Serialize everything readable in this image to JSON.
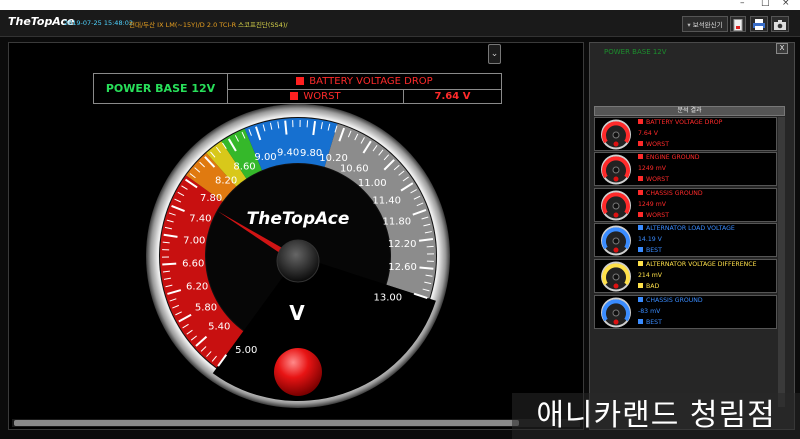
{
  "window": {
    "minimize": "–",
    "maximize": "□",
    "close": "×"
  },
  "header": {
    "logo": "TheTopAce",
    "datetime": "2019-07-25 15:48:02",
    "vehicle": "현대/두산 IX LM(~15Y)/D 2.0 TCI-R",
    "procedure": "스코프진단(SS4)/",
    "report_button": "보석완신기",
    "tool_icons": [
      "document-icon",
      "printer-icon",
      "camera-icon"
    ]
  },
  "main": {
    "dropdown_symbol": "⌄",
    "power_base": "POWER BASE 12V",
    "test_name": "BATTERY VOLTAGE DROP",
    "grade": "WORST",
    "measured_value": "7.64 V"
  },
  "gauge": {
    "brand": "TheTopAce",
    "unit": "V",
    "min": 5.0,
    "max": 13.0,
    "value": 7.64,
    "tick_labels": [
      "5.00",
      "5.40",
      "5.80",
      "6.20",
      "6.60",
      "7.00",
      "7.40",
      "7.80",
      "8.20",
      "8.60",
      "9.00",
      "9.40",
      "9.80",
      "10.20",
      "10.60",
      "11.00",
      "11.40",
      "11.80",
      "12.20",
      "12.60",
      "13.00"
    ],
    "colors": {
      "red": "#c81010",
      "orange": "#e07a10",
      "yellow": "#d8c81a",
      "green": "#35b82a",
      "blue": "#1670d0",
      "gray": "#8c8c8c",
      "needle": "#d01414"
    }
  },
  "analysis": {
    "panel_title": "POWER BASE 12V",
    "close_label": "X",
    "header": "분석 결과",
    "items": [
      {
        "name": "BATTERY VOLTAGE DROP",
        "value": "7.64 V",
        "grade": "WORST",
        "name_color": "#ff2a2a",
        "grade_color": "#ff2a2a",
        "square_color": "#ff2a2a"
      },
      {
        "name": "ENGINE GROUND",
        "value": "1249 mV",
        "grade": "WORST",
        "name_color": "#ff2a2a",
        "grade_color": "#ff2a2a",
        "square_color": "#ff2a2a"
      },
      {
        "name": "CHASSIS GROUND",
        "value": "1249 mV",
        "grade": "WORST",
        "name_color": "#ff2a2a",
        "grade_color": "#ff2a2a",
        "square_color": "#ff2a2a"
      },
      {
        "name": "ALTERNATOR LOAD VOLTAGE",
        "value": "14.19 V",
        "grade": "BEST",
        "name_color": "#3a8cff",
        "grade_color": "#3a8cff",
        "square_color": "#3a8cff"
      },
      {
        "name": "ALTERNATOR VOLTAGE DIFFERENCE",
        "value": "214 mV",
        "grade": "BAD",
        "name_color": "#ffe14a",
        "grade_color": "#ffe14a",
        "square_color": "#ffe14a"
      },
      {
        "name": "CHASSIS GROUND",
        "value": "-83 mV",
        "grade": "BEST",
        "name_color": "#3a8cff",
        "grade_color": "#3a8cff",
        "square_color": "#3a8cff"
      }
    ]
  },
  "watermark": "애니카랜드 청림점"
}
